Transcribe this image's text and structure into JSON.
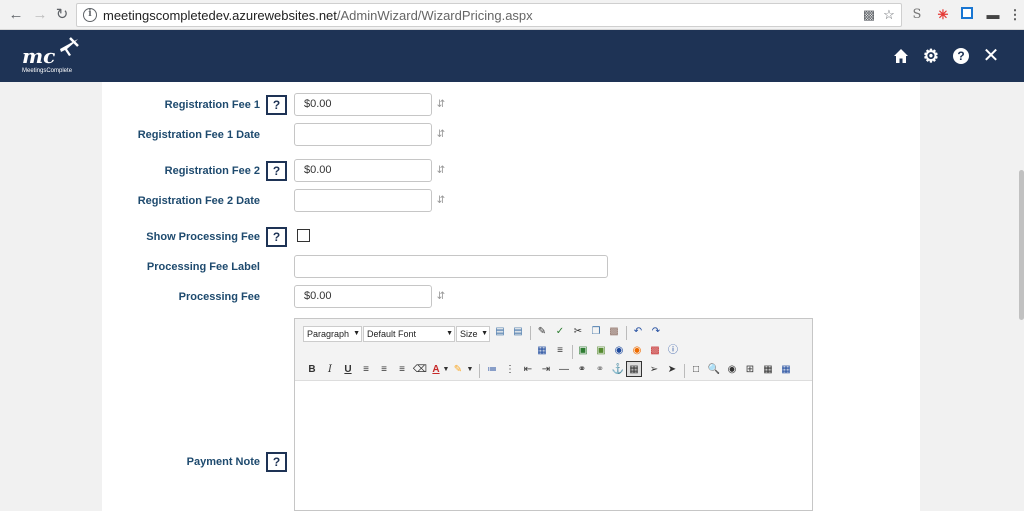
{
  "browser": {
    "url_domain": "meetingscompletedev.azurewebsites.net",
    "url_path": "/AdminWizard/WizardPricing.aspx"
  },
  "app": {
    "logo_text": "mc",
    "logo_subtext": "MeetingsComplete"
  },
  "form": {
    "help_label": "?",
    "fields": {
      "reg_fee_1": {
        "label": "Registration Fee 1",
        "value": "$0.00"
      },
      "reg_fee_1_date": {
        "label": "Registration Fee 1 Date",
        "value": ""
      },
      "reg_fee_2": {
        "label": "Registration Fee 2",
        "value": "$0.00"
      },
      "reg_fee_2_date": {
        "label": "Registration Fee 2 Date",
        "value": ""
      },
      "show_processing_fee": {
        "label": "Show Processing Fee",
        "checked": false
      },
      "processing_fee_label": {
        "label": "Processing Fee Label",
        "value": ""
      },
      "processing_fee": {
        "label": "Processing Fee",
        "value": "$0.00"
      },
      "payment_note": {
        "label": "Payment Note"
      }
    }
  },
  "editor": {
    "paragraph": "Paragraph",
    "font": "Default Font",
    "size": "Size"
  }
}
